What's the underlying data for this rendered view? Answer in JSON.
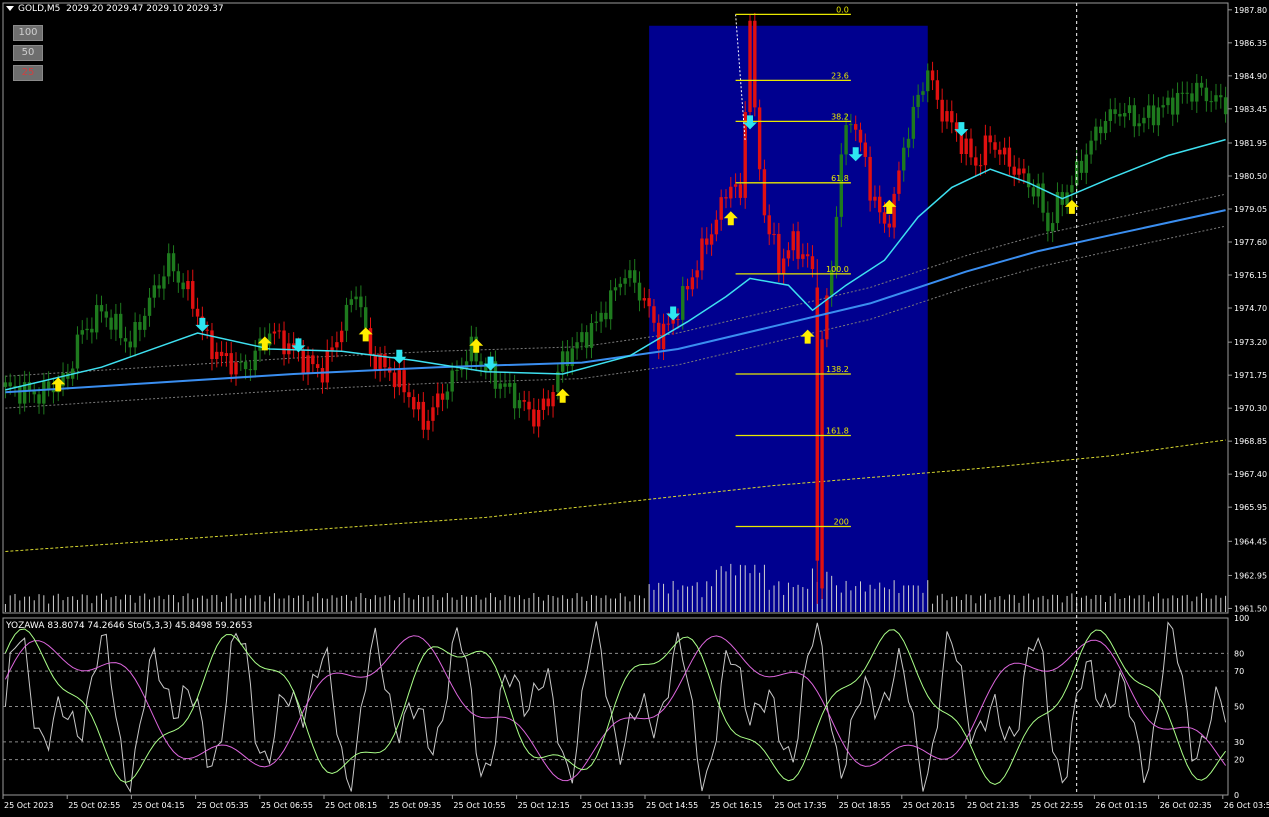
{
  "header": {
    "symbol": "GOLD,M5",
    "ohlc": "2029.20 2029.47 2029.10 2029.37"
  },
  "scale_buttons": [
    {
      "label": "100",
      "active": false
    },
    {
      "label": "50",
      "active": false
    },
    {
      "label": "25",
      "active": true
    }
  ],
  "indicator": {
    "title": "YOZAWA 83.8074 74.2646  Sto(5,3,3) 45.8498 59.2653",
    "levels": [
      "100",
      "80",
      "70",
      "50",
      "30",
      "20",
      "0"
    ]
  },
  "fib_labels": [
    "0.0",
    "23.6",
    "38.2",
    "61.8",
    "100.0",
    "138.2",
    "161.8",
    "200"
  ],
  "colors": {
    "bull": "#1e7a1e",
    "bear": "#e01010",
    "ma_fast": "#3ee0f0",
    "ma_slow": "#3a8ef0",
    "band": "#7a7a7a",
    "long_ma": "#d8d830",
    "zone": "#00008f",
    "fib": "#e8e800",
    "arrow_up": "#ffee00",
    "arrow_down": "#2ee6f0",
    "stoch_main": "#c8c8c8",
    "stoch_signal": "#dd66dd",
    "yozawa": "#aaff88"
  },
  "chart_data": {
    "type": "candlestick",
    "symbol": "GOLD",
    "timeframe": "M5",
    "y_ticks": [
      "1987.80",
      "1986.35",
      "1984.90",
      "1983.45",
      "1981.95",
      "1980.50",
      "1979.05",
      "1977.60",
      "1976.15",
      "1974.70",
      "1973.20",
      "1971.75",
      "1970.30",
      "1968.85",
      "1967.40",
      "1965.95",
      "1964.45",
      "1962.95",
      "1961.50"
    ],
    "y_range": [
      1961.3,
      1988.1
    ],
    "x_ticks": [
      "25 Oct 2023",
      "25 Oct 02:55",
      "25 Oct 04:15",
      "25 Oct 05:35",
      "25 Oct 06:55",
      "25 Oct 08:15",
      "25 Oct 09:35",
      "25 Oct 10:55",
      "25 Oct 12:15",
      "25 Oct 13:35",
      "25 Oct 14:55",
      "25 Oct 16:15",
      "25 Oct 17:35",
      "25 Oct 18:55",
      "25 Oct 20:15",
      "25 Oct 21:35",
      "25 Oct 22:55",
      "26 Oct 01:15",
      "26 Oct 02:35",
      "26 Oct 03:55"
    ],
    "price_path": [
      [
        0,
        1971.2
      ],
      [
        7,
        1970.9
      ],
      [
        13,
        1971.6
      ],
      [
        15,
        1973.3
      ],
      [
        20,
        1974.6
      ],
      [
        26,
        1973.1
      ],
      [
        30,
        1975.0
      ],
      [
        34,
        1976.7
      ],
      [
        39,
        1975.0
      ],
      [
        42,
        1973.2
      ],
      [
        45,
        1972.5
      ],
      [
        50,
        1972.0
      ],
      [
        55,
        1973.7
      ],
      [
        58,
        1973.2
      ],
      [
        62,
        1972.4
      ],
      [
        66,
        1971.9
      ],
      [
        70,
        1973.9
      ],
      [
        73,
        1975.6
      ],
      [
        76,
        1972.6
      ],
      [
        80,
        1971.9
      ],
      [
        84,
        1970.9
      ],
      [
        87,
        1969.6
      ],
      [
        90,
        1970.6
      ],
      [
        93,
        1971.6
      ],
      [
        97,
        1972.9
      ],
      [
        100,
        1972.0
      ],
      [
        103,
        1971.4
      ],
      [
        107,
        1970.6
      ],
      [
        110,
        1969.9
      ],
      [
        113,
        1970.6
      ],
      [
        116,
        1972.4
      ],
      [
        119,
        1973.1
      ],
      [
        123,
        1974.0
      ],
      [
        126,
        1975.1
      ],
      [
        129,
        1976.3
      ],
      [
        133,
        1975.1
      ],
      [
        136,
        1973.4
      ],
      [
        139,
        1974.2
      ],
      [
        142,
        1975.6
      ],
      [
        145,
        1977.2
      ],
      [
        148,
        1978.6
      ],
      [
        151,
        1980.3
      ],
      [
        153,
        1979.4
      ],
      [
        155,
        1987.6
      ],
      [
        156,
        1983.0
      ],
      [
        158,
        1978.9
      ],
      [
        161,
        1976.6
      ],
      [
        164,
        1977.6
      ],
      [
        167,
        1976.8
      ],
      [
        168,
        1976.2
      ],
      [
        169,
        1962.8
      ],
      [
        170,
        1973.3
      ],
      [
        172,
        1976.5
      ],
      [
        174,
        1981.4
      ],
      [
        176,
        1983.2
      ],
      [
        178,
        1981.9
      ],
      [
        180,
        1980.0
      ],
      [
        183,
        1978.2
      ],
      [
        185,
        1979.4
      ],
      [
        187,
        1981.8
      ],
      [
        190,
        1983.9
      ],
      [
        192,
        1985.2
      ],
      [
        194,
        1983.7
      ],
      [
        196,
        1983.1
      ],
      [
        199,
        1982.0
      ],
      [
        202,
        1981.0
      ],
      [
        205,
        1982.1
      ],
      [
        208,
        1981.3
      ],
      [
        212,
        1980.4
      ],
      [
        215,
        1979.7
      ],
      [
        217,
        1978.2
      ],
      [
        219,
        1979.2
      ],
      [
        222,
        1980.2
      ],
      [
        225,
        1981.5
      ],
      [
        228,
        1982.8
      ],
      [
        232,
        1983.4
      ],
      [
        236,
        1982.9
      ],
      [
        240,
        1983.4
      ],
      [
        244,
        1983.9
      ],
      [
        248,
        1984.3
      ],
      [
        252,
        1983.8
      ],
      [
        254,
        1983.7
      ]
    ],
    "bear_segments": [
      [
        38,
        48
      ],
      [
        56,
        70
      ],
      [
        76,
        91
      ],
      [
        108,
        114
      ],
      [
        133,
        140
      ],
      [
        142,
        167
      ],
      [
        168,
        171
      ],
      [
        177,
        186
      ],
      [
        193,
        212
      ]
    ],
    "moving_averages": {
      "fast": [
        [
          0,
          1971.1
        ],
        [
          20,
          1972.1
        ],
        [
          40,
          1973.6
        ],
        [
          55,
          1972.9
        ],
        [
          70,
          1972.8
        ],
        [
          85,
          1972.4
        ],
        [
          100,
          1971.9
        ],
        [
          116,
          1971.8
        ],
        [
          130,
          1972.6
        ],
        [
          142,
          1974.1
        ],
        [
          150,
          1975.2
        ],
        [
          155,
          1976.0
        ],
        [
          163,
          1975.7
        ],
        [
          168,
          1974.6
        ],
        [
          175,
          1975.7
        ],
        [
          183,
          1976.8
        ],
        [
          190,
          1978.7
        ],
        [
          197,
          1980.0
        ],
        [
          205,
          1980.8
        ],
        [
          213,
          1980.2
        ],
        [
          220,
          1979.5
        ],
        [
          230,
          1980.4
        ],
        [
          242,
          1981.4
        ],
        [
          254,
          1982.1
        ]
      ],
      "slow": [
        [
          0,
          1971.0
        ],
        [
          30,
          1971.4
        ],
        [
          60,
          1971.8
        ],
        [
          90,
          1972.1
        ],
        [
          120,
          1972.3
        ],
        [
          140,
          1972.9
        ],
        [
          160,
          1973.9
        ],
        [
          180,
          1974.9
        ],
        [
          200,
          1976.3
        ],
        [
          215,
          1977.2
        ],
        [
          230,
          1977.9
        ],
        [
          254,
          1979.0
        ]
      ],
      "long": [
        [
          0,
          1964.0
        ],
        [
          100,
          1965.5
        ],
        [
          160,
          1966.9
        ],
        [
          200,
          1967.6
        ],
        [
          230,
          1968.2
        ],
        [
          254,
          1968.9
        ]
      ]
    },
    "signal_arrows": [
      {
        "bar": 11,
        "dir": "up",
        "price": 1971.3
      },
      {
        "bar": 41,
        "dir": "down",
        "price": 1974.0
      },
      {
        "bar": 54,
        "dir": "up",
        "price": 1973.1
      },
      {
        "bar": 61,
        "dir": "down",
        "price": 1973.1
      },
      {
        "bar": 75,
        "dir": "up",
        "price": 1973.5
      },
      {
        "bar": 82,
        "dir": "down",
        "price": 1972.6
      },
      {
        "bar": 98,
        "dir": "up",
        "price": 1973.0
      },
      {
        "bar": 101,
        "dir": "down",
        "price": 1972.3
      },
      {
        "bar": 116,
        "dir": "up",
        "price": 1970.8
      },
      {
        "bar": 139,
        "dir": "down",
        "price": 1974.5
      },
      {
        "bar": 151,
        "dir": "up",
        "price": 1978.6
      },
      {
        "bar": 155,
        "dir": "down",
        "price": 1982.9
      },
      {
        "bar": 167,
        "dir": "up",
        "price": 1973.4
      },
      {
        "bar": 177,
        "dir": "down",
        "price": 1981.5
      },
      {
        "bar": 184,
        "dir": "up",
        "price": 1979.1
      },
      {
        "bar": 199,
        "dir": "down",
        "price": 1982.6
      },
      {
        "bar": 222,
        "dir": "up",
        "price": 1979.1
      }
    ],
    "fibonacci": {
      "bar_start": 152,
      "bar_end": 176,
      "levels": [
        {
          "label": "0.0",
          "price": 1987.6
        },
        {
          "label": "23.6",
          "price": 1984.7
        },
        {
          "label": "38.2",
          "price": 1982.9
        },
        {
          "label": "61.8",
          "price": 1980.2
        },
        {
          "label": "100.0",
          "price": 1976.2
        },
        {
          "label": "138.2",
          "price": 1971.8
        },
        {
          "label": "161.8",
          "price": 1969.1
        },
        {
          "label": "200",
          "price": 1965.1
        }
      ]
    },
    "highlight_zone": {
      "bar_start": 134,
      "bar_end": 192
    },
    "crosshair_bar": 223,
    "indicator_panel": {
      "name": "YOZAWA / Sto(5,3,3)",
      "yozawa": 83.8074,
      "yozawa_signal": 74.2646,
      "sto_main": 45.8498,
      "sto_signal": 59.2653,
      "levels": [
        100,
        80,
        70,
        50,
        30,
        20,
        0
      ]
    }
  }
}
